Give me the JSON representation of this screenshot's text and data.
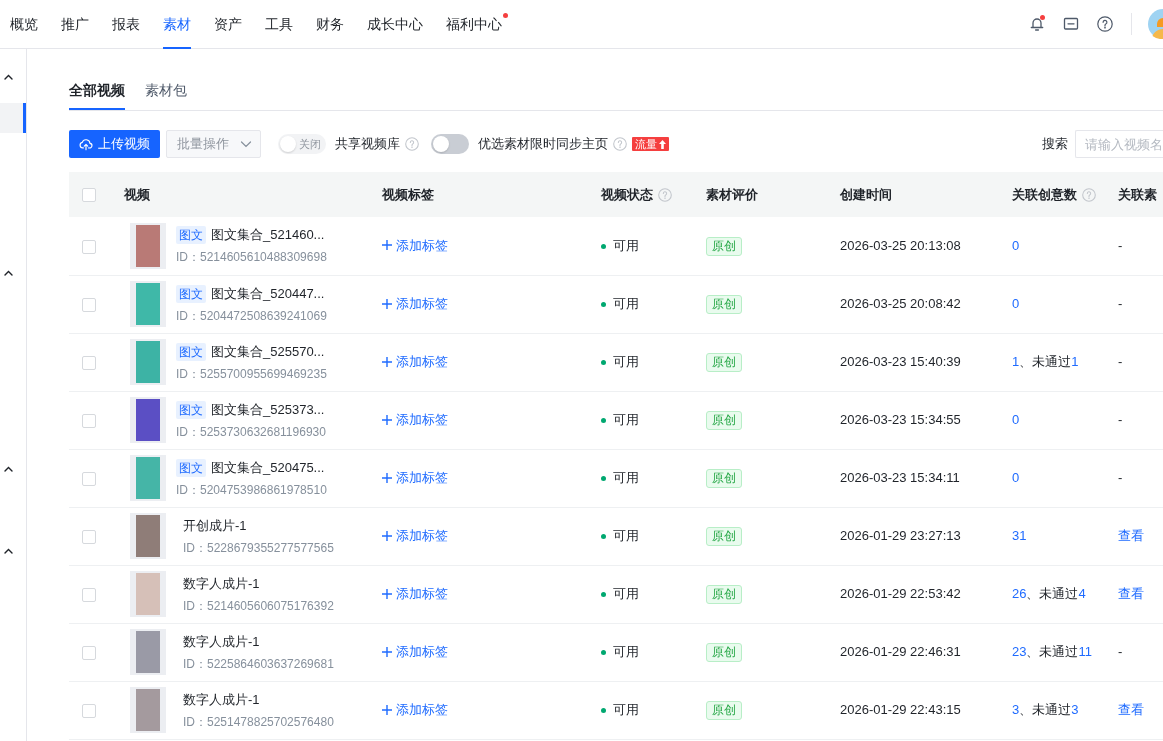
{
  "top_nav": {
    "items": [
      {
        "label": "概览",
        "selected": false,
        "dot": false
      },
      {
        "label": "推广",
        "selected": false,
        "dot": false
      },
      {
        "label": "报表",
        "selected": false,
        "dot": false
      },
      {
        "label": "素材",
        "selected": true,
        "dot": false
      },
      {
        "label": "资产",
        "selected": false,
        "dot": false
      },
      {
        "label": "工具",
        "selected": false,
        "dot": false
      },
      {
        "label": "财务",
        "selected": false,
        "dot": false
      },
      {
        "label": "成长中心",
        "selected": false,
        "dot": false
      },
      {
        "label": "福利中心",
        "selected": false,
        "dot": true
      }
    ],
    "bell_dot": true
  },
  "sidebar": {
    "groups": [
      {
        "expanded": true,
        "items": [
          {
            "selected": true
          }
        ]
      },
      {
        "expanded": true
      },
      {
        "expanded": true
      },
      {
        "expanded": true
      }
    ]
  },
  "tabs": [
    {
      "label": "全部视频",
      "selected": true
    },
    {
      "label": "素材包",
      "selected": false
    }
  ],
  "toolbar": {
    "upload_button": "上传视频",
    "batch_select": {
      "label": "批量操作",
      "disabled": true
    },
    "switches": [
      {
        "label": "共享视频库",
        "on": false,
        "disabled": true,
        "switch_text": "关闭",
        "help": true
      },
      {
        "label": "优选素材限时同步主页",
        "on": false,
        "disabled": false,
        "help": true,
        "badge": "流量"
      }
    ],
    "search": {
      "label": "搜索",
      "placeholder": "请输入视频名"
    }
  },
  "table": {
    "select_all_checked": false,
    "columns": [
      {
        "label": "视频",
        "help": false
      },
      {
        "label": "视频标签",
        "help": false
      },
      {
        "label": "视频状态",
        "help": true
      },
      {
        "label": "素材评价",
        "help": false
      },
      {
        "label": "创建时间",
        "help": false
      },
      {
        "label": "关联创意数",
        "help": true
      },
      {
        "label": "关联素",
        "help": false
      }
    ],
    "rows": [
      {
        "selected": false,
        "color": "#b97a76",
        "tag": "图文",
        "name": "图文集合_521460...",
        "id": "ID：5214605610488309698",
        "tag_action": "添加标签",
        "status": {
          "text": "可用",
          "color": "#00a870"
        },
        "rating": "原创",
        "created": "2026-03-25 20:13:08",
        "creatives": [
          {
            "kind": "link",
            "text": "0"
          }
        ],
        "material": {
          "kind": "text",
          "text": "-"
        }
      },
      {
        "selected": false,
        "color": "#3fb8a8",
        "tag": "图文",
        "name": "图文集合_520447...",
        "id": "ID：5204472508639241069",
        "tag_action": "添加标签",
        "status": {
          "text": "可用",
          "color": "#00a870"
        },
        "rating": "原创",
        "created": "2026-03-25 20:08:42",
        "creatives": [
          {
            "kind": "link",
            "text": "0"
          }
        ],
        "material": {
          "kind": "text",
          "text": "-"
        }
      },
      {
        "selected": false,
        "color": "#3db3a5",
        "tag": "图文",
        "name": "图文集合_525570...",
        "id": "ID：5255700955699469235",
        "tag_action": "添加标签",
        "status": {
          "text": "可用",
          "color": "#00a870"
        },
        "rating": "原创",
        "created": "2026-03-23 15:40:39",
        "creatives": [
          {
            "kind": "link",
            "text": "1"
          },
          {
            "kind": "text",
            "text": "、未通过"
          },
          {
            "kind": "link",
            "text": "1"
          }
        ],
        "material": {
          "kind": "text",
          "text": "-"
        }
      },
      {
        "selected": false,
        "color": "#5b4fc4",
        "tag": "图文",
        "name": "图文集合_525373...",
        "id": "ID：5253730632681196930",
        "tag_action": "添加标签",
        "status": {
          "text": "可用",
          "color": "#00a870"
        },
        "rating": "原创",
        "created": "2026-03-23 15:34:55",
        "creatives": [
          {
            "kind": "link",
            "text": "0"
          }
        ],
        "material": {
          "kind": "text",
          "text": "-"
        }
      },
      {
        "selected": false,
        "color": "#45b5a7",
        "tag": "图文",
        "name": "图文集合_520475...",
        "id": "ID：5204753986861978510",
        "tag_action": "添加标签",
        "status": {
          "text": "可用",
          "color": "#00a870"
        },
        "rating": "原创",
        "created": "2026-03-23 15:34:11",
        "creatives": [
          {
            "kind": "link",
            "text": "0"
          }
        ],
        "material": {
          "kind": "text",
          "text": "-"
        }
      },
      {
        "selected": false,
        "color": "#8f7d78",
        "name": "开创成片-1",
        "id": "ID：5228679355277577565",
        "tag_action": "添加标签",
        "status": {
          "text": "可用",
          "color": "#00a870"
        },
        "rating": "原创",
        "created": "2026-01-29 23:27:13",
        "creatives": [
          {
            "kind": "link",
            "text": "31"
          }
        ],
        "material": {
          "kind": "link",
          "text": "查看"
        }
      },
      {
        "selected": false,
        "color": "#d6c0b8",
        "name": "数字人成片-1",
        "id": "ID：5214605606075176392",
        "tag_action": "添加标签",
        "status": {
          "text": "可用",
          "color": "#00a870"
        },
        "rating": "原创",
        "created": "2026-01-29 22:53:42",
        "creatives": [
          {
            "kind": "link",
            "text": "26"
          },
          {
            "kind": "text",
            "text": "、未通过"
          },
          {
            "kind": "link",
            "text": "4"
          }
        ],
        "material": {
          "kind": "link",
          "text": "查看"
        }
      },
      {
        "selected": false,
        "color": "#9a9aa6",
        "name": "数字人成片-1",
        "id": "ID：5225864603637269681",
        "tag_action": "添加标签",
        "status": {
          "text": "可用",
          "color": "#00a870"
        },
        "rating": "原创",
        "created": "2026-01-29 22:46:31",
        "creatives": [
          {
            "kind": "link",
            "text": "23"
          },
          {
            "kind": "text",
            "text": "、未通过"
          },
          {
            "kind": "link",
            "text": "11"
          }
        ],
        "material": {
          "kind": "text",
          "text": "-"
        }
      },
      {
        "selected": false,
        "color": "#a49a9e",
        "name": "数字人成片-1",
        "id": "ID：5251478825702576480",
        "tag_action": "添加标签",
        "status": {
          "text": "可用",
          "color": "#00a870"
        },
        "rating": "原创",
        "created": "2026-01-29 22:43:15",
        "creatives": [
          {
            "kind": "link",
            "text": "3"
          },
          {
            "kind": "text",
            "text": "、未通过"
          },
          {
            "kind": "link",
            "text": "3"
          }
        ],
        "material": {
          "kind": "link",
          "text": "查看"
        }
      }
    ]
  }
}
